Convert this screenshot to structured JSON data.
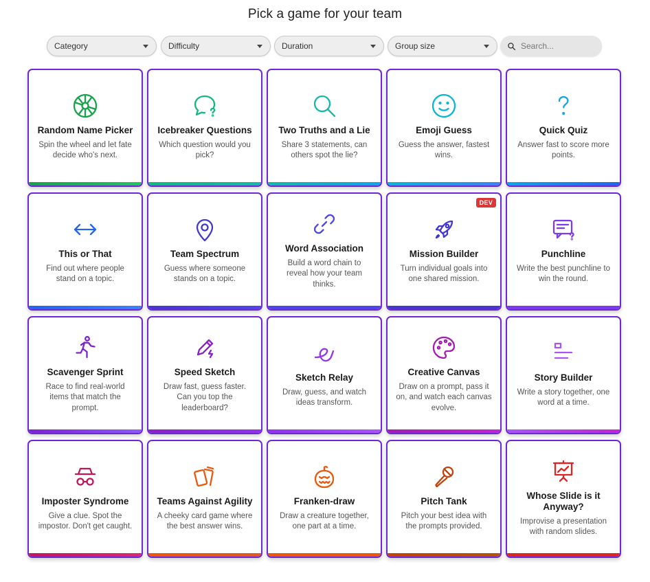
{
  "page": {
    "title": "Pick a game for your team"
  },
  "filters": {
    "category": "Category",
    "difficulty": "Difficulty",
    "duration": "Duration",
    "group_size": "Group size",
    "search_placeholder": "Search..."
  },
  "games": [
    {
      "name": "Random Name Picker",
      "desc": "Spin the wheel and let fate decide who's next.",
      "icon": "wheel-icon",
      "color": "#16a34a",
      "bar": "#22c55e"
    },
    {
      "name": "Icebreaker Questions",
      "desc": "Which question would you pick?",
      "icon": "chat-question-icon",
      "color": "#10b981",
      "bar": "#14b8a6"
    },
    {
      "name": "Two Truths and a Lie",
      "desc": "Share 3 statements, can others spot the lie?",
      "icon": "magnifier-icon",
      "color": "#14b8a6",
      "bar": "#0ea5e9"
    },
    {
      "name": "Emoji Guess",
      "desc": "Guess the answer, fastest wins.",
      "icon": "smiley-icon",
      "color": "#06b6d4",
      "bar": "#3b82f6"
    },
    {
      "name": "Quick Quiz",
      "desc": "Answer fast to score more points.",
      "icon": "question-mark-icon",
      "color": "#0ea5e9",
      "bar": "#2563eb"
    },
    {
      "name": "This or That",
      "desc": "Find out where people stand on a topic.",
      "icon": "arrows-left-right-icon",
      "color": "#2563eb",
      "bar": "#3b82f6"
    },
    {
      "name": "Team Spectrum",
      "desc": "Guess where someone stands on a topic.",
      "icon": "location-pin-icon",
      "color": "#4338ca",
      "bar": "#4f46e5"
    },
    {
      "name": "Word Association",
      "desc": "Build a word chain to reveal how your team thinks.",
      "icon": "link-icon",
      "color": "#4f46e5",
      "bar": "#4f46e5"
    },
    {
      "name": "Mission Builder",
      "desc": "Turn individual goals into one shared mission.",
      "icon": "rocket-icon",
      "color": "#4338ca",
      "bar": "#4338ca",
      "badge": "DEV"
    },
    {
      "name": "Punchline",
      "desc": "Write the best punchline to win the round.",
      "icon": "message-question-icon",
      "color": "#7c3aed",
      "bar": "#7c3aed"
    },
    {
      "name": "Scavenger Sprint",
      "desc": "Race to find real-world items that match the prompt.",
      "icon": "running-person-icon",
      "color": "#7e22ce",
      "bar": "#8b5cf6"
    },
    {
      "name": "Speed Sketch",
      "desc": "Draw fast, guess faster. Can you top the leaderboard?",
      "icon": "pencil-bolt-icon",
      "color": "#8b22c7",
      "bar": "#9333ea"
    },
    {
      "name": "Sketch Relay",
      "desc": "Draw, guess, and watch ideas transform.",
      "icon": "scribble-icon",
      "color": "#9333ea",
      "bar": "#a855f7"
    },
    {
      "name": "Creative Canvas",
      "desc": "Draw on a prompt, pass it on, and watch each canvas evolve.",
      "icon": "palette-icon",
      "color": "#a21caf",
      "bar": "#c026d3"
    },
    {
      "name": "Story Builder",
      "desc": "Write a story together, one word at a time.",
      "icon": "text-lines-icon",
      "color": "#a855f7",
      "bar": "#c026d3"
    },
    {
      "name": "Imposter Syndrome",
      "desc": "Give a clue. Spot the impostor. Don't get caught.",
      "icon": "spy-icon",
      "color": "#be185d",
      "bar": "#db2777"
    },
    {
      "name": "Teams Against Agility",
      "desc": "A cheeky card game where the best answer wins.",
      "icon": "cards-icon",
      "color": "#ea580c",
      "bar": "#e25822"
    },
    {
      "name": "Franken-draw",
      "desc": "Draw a creature together, one part at a time.",
      "icon": "pumpkin-icon",
      "color": "#ea580c",
      "bar": "#ea580c"
    },
    {
      "name": "Pitch Tank",
      "desc": "Pitch your best idea with the prompts provided.",
      "icon": "microphone-icon",
      "color": "#c2410c",
      "bar": "#b45309"
    },
    {
      "name": "Whose Slide is it Anyway?",
      "desc": "Improvise a presentation with random slides.",
      "icon": "presentation-icon",
      "color": "#dc2626",
      "bar": "#dc2626"
    }
  ]
}
